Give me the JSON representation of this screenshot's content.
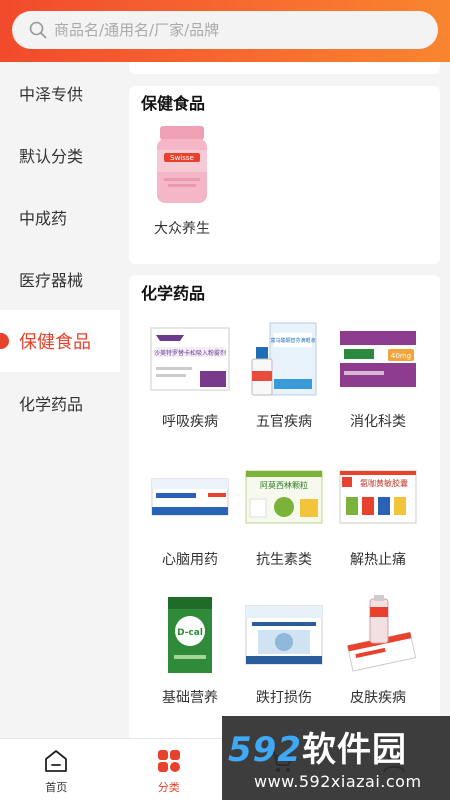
{
  "search": {
    "placeholder": "商品名/通用名/厂家/品牌"
  },
  "sidebar": {
    "items": [
      {
        "label": "中泽专供"
      },
      {
        "label": "默认分类"
      },
      {
        "label": "中成药"
      },
      {
        "label": "医疗器械"
      },
      {
        "label": "保健食品",
        "active": true
      },
      {
        "label": "化学药品"
      }
    ]
  },
  "sections": {
    "health": {
      "title": "保健食品",
      "items": [
        {
          "label": "大众养生",
          "image_text": "Swisse"
        }
      ]
    },
    "chemical": {
      "title": "化学药品",
      "items": [
        {
          "label": "呼吸疾病",
          "image_text": "沙美特罗替卡松吸入粉雾剂"
        },
        {
          "label": "五官疾病",
          "image_text": "富马酸酮替芬滴眼液"
        },
        {
          "label": "消化科类",
          "image_text": "40mg"
        },
        {
          "label": "心脑用药"
        },
        {
          "label": "抗生素类",
          "image_text": "阿莫西林颗粒"
        },
        {
          "label": "解热止痛",
          "image_text": "氨咖黄敏胶囊"
        },
        {
          "label": "基础营养",
          "image_text": "D-cal"
        },
        {
          "label": "跌打损伤"
        },
        {
          "label": "皮肤疾病"
        }
      ]
    }
  },
  "tabbar": {
    "items": [
      {
        "label": "首页",
        "icon": "home-icon"
      },
      {
        "label": "分类",
        "icon": "category-icon",
        "active": true
      },
      {
        "label": "",
        "icon": "cart-icon"
      },
      {
        "label": "",
        "icon": "profile-icon"
      }
    ]
  },
  "watermark": {
    "digits": "592",
    "name": "软件园",
    "url": "www.592xiazai.com"
  },
  "colors": {
    "accent": "#e8412e",
    "header_start": "#f14a2c",
    "header_end": "#f9852f"
  }
}
